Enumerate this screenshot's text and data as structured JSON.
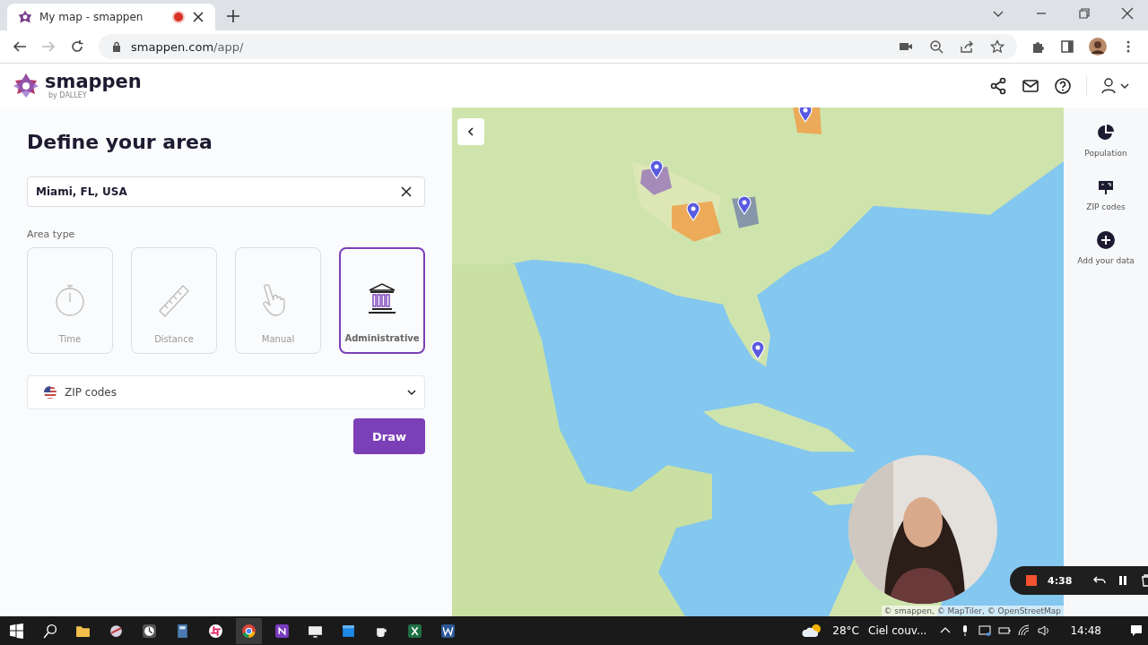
{
  "browser": {
    "tab_title": "My map - smappen",
    "url_host": "smappen.com",
    "url_path": "/app/"
  },
  "app": {
    "logo": "smappen",
    "logo_byline": "by DALLEY"
  },
  "panel": {
    "title": "Define your area",
    "search": {
      "value": "Miami, FL, USA"
    },
    "area_type_label": "Area type",
    "area_types": [
      {
        "kind": "time",
        "label": "Time",
        "selected": false
      },
      {
        "kind": "distance",
        "label": "Distance",
        "selected": false
      },
      {
        "kind": "manual",
        "label": "Manual",
        "selected": false
      },
      {
        "kind": "administrative",
        "label": "Administrative",
        "selected": true
      }
    ],
    "dropdown": {
      "value": "ZIP codes"
    },
    "draw_button": "Draw"
  },
  "map": {
    "attribution": "© smappen, © MapTiler, © OpenStreetMap"
  },
  "rail": [
    {
      "kind": "population",
      "label": "Population"
    },
    {
      "kind": "zip",
      "label": "ZIP codes"
    },
    {
      "kind": "add",
      "label": "Add your data"
    }
  ],
  "recorder": {
    "time": "4:38"
  },
  "taskbar": {
    "temperature": "28°C",
    "weather": "Ciel couv...",
    "clock": "14:48"
  }
}
